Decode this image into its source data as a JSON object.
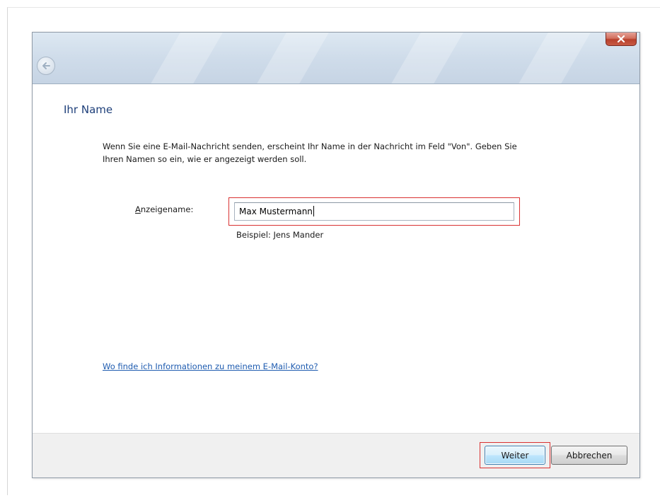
{
  "page": {
    "title": "Ihr Name",
    "description": "Wenn Sie eine E-Mail-Nachricht senden, erscheint Ihr Name in der Nachricht im Feld \"Von\". Geben Sie Ihren Namen so ein, wie er angezeigt werden soll."
  },
  "form": {
    "display_name_label_mnemonic": "A",
    "display_name_label_rest": "nzeigename:",
    "display_name_value": "Max Mustermann",
    "example": "Beispiel: Jens Mander"
  },
  "help_link": "Wo finde ich Informationen zu meinem E-Mail-Konto?",
  "footer": {
    "next_label": "Weiter",
    "cancel_label": "Abbrechen"
  },
  "icons": {
    "back": "back-arrow-icon",
    "close": "close-x-icon"
  },
  "colors": {
    "title": "#1e3f7a",
    "link": "#1f5cb0",
    "highlight": "#d93232",
    "close_button": "#c85a44"
  }
}
